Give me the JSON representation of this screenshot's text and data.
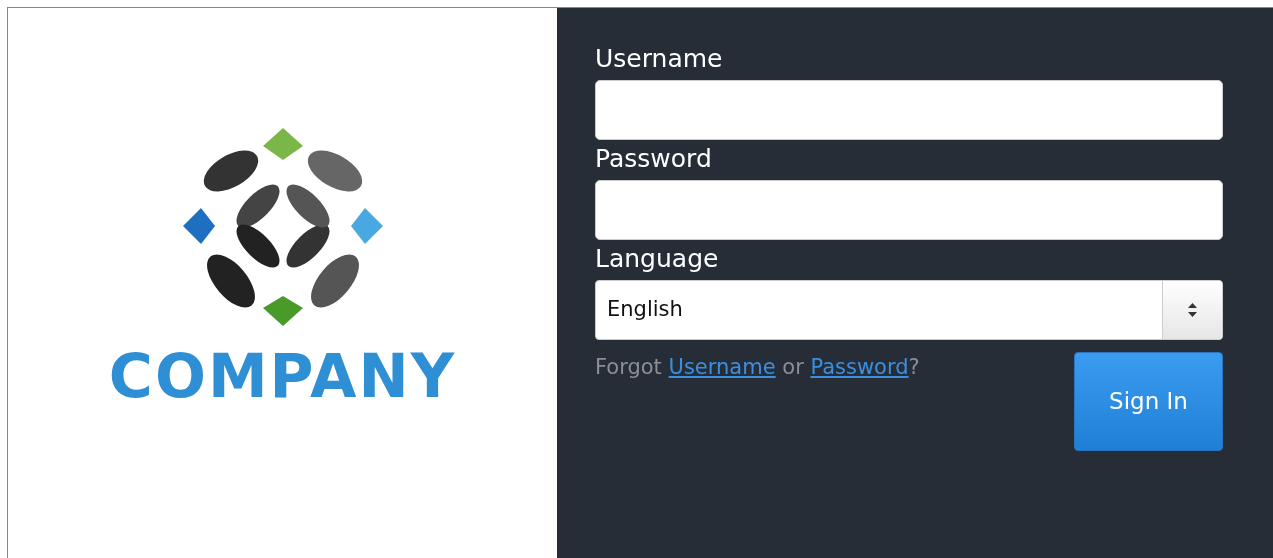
{
  "logo": {
    "text": "COMPANY"
  },
  "form": {
    "fields": [
      {
        "kind": "input",
        "label": "Username"
      },
      {
        "kind": "input",
        "label": "Password"
      },
      {
        "kind": "select",
        "label": "Language",
        "value": "English"
      }
    ],
    "forgot": [
      {
        "kind": "text",
        "text": "Forgot"
      },
      {
        "kind": "link",
        "text": "Username"
      },
      {
        "kind": "text",
        "text": "or"
      },
      {
        "kind": "link",
        "text": "Password"
      },
      {
        "kind": "text",
        "text": "?"
      }
    ],
    "submit": "Sign In"
  }
}
